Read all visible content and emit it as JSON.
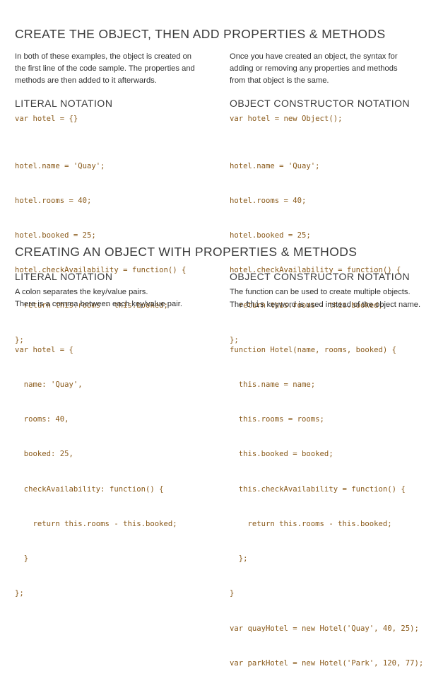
{
  "section1": {
    "title": "CREATE THE OBJECT, THEN ADD PROPERTIES & METHODS",
    "left_intro": [
      "In both of these examples, the object is created on",
      "the first line of the code sample. The properties and",
      "methods are then added to it afterwards."
    ],
    "right_intro": [
      "Once you have created an object, the syntax for",
      "adding or removing any properties and methods",
      "from that object is the same."
    ],
    "left_heading": "LITERAL NOTATION",
    "right_heading": "OBJECT CONSTRUCTOR NOTATION",
    "left_code_first": "var hotel = {}",
    "right_code_first": "var hotel = new Object();",
    "left_code": [
      "hotel.name = 'Quay';",
      "hotel.rooms = 40;",
      "hotel.booked = 25;",
      "hotel.checkAvailability = function() {",
      "  return this.rooms - this.booked;",
      "};"
    ],
    "right_code": [
      "hotel.name = 'Quay';",
      "hotel.rooms = 40;",
      "hotel.booked = 25;",
      "hotel.checkAvailability = function() {",
      "  return this.rooms - this.booked;",
      "};"
    ]
  },
  "section2": {
    "title": "CREATING AN OBJECT WITH PROPERTIES & METHODS",
    "left_heading": "LITERAL NOTATION",
    "right_heading": "OBJECT CONSTRUCTOR NOTATION",
    "left_intro": [
      "A colon separates the key/value pairs.",
      "There is a comma between each key/value pair."
    ],
    "right_intro_line1": "The function can be used to create multiple objects.",
    "right_intro_line2_before": "The ",
    "right_intro_line2_keyword": "this",
    "right_intro_line2_after": " keyword is used instead of the object name.",
    "left_code": [
      "var hotel = {",
      "  name: 'Quay',",
      "  rooms: 40,",
      "  booked: 25,",
      "  checkAvailability: function() {",
      "    return this.rooms - this.booked;",
      "  }",
      "};"
    ],
    "right_code": [
      "function Hotel(name, rooms, booked) {",
      "  this.name = name;",
      "  this.rooms = rooms;",
      "  this.booked = booked;",
      "  this.checkAvailability = function() {",
      "    return this.rooms - this.booked;",
      "  };",
      "}",
      "var quayHotel = new Hotel('Quay', 40, 25);",
      "var parkHotel = new Hotel('Park', 120, 77);"
    ]
  }
}
